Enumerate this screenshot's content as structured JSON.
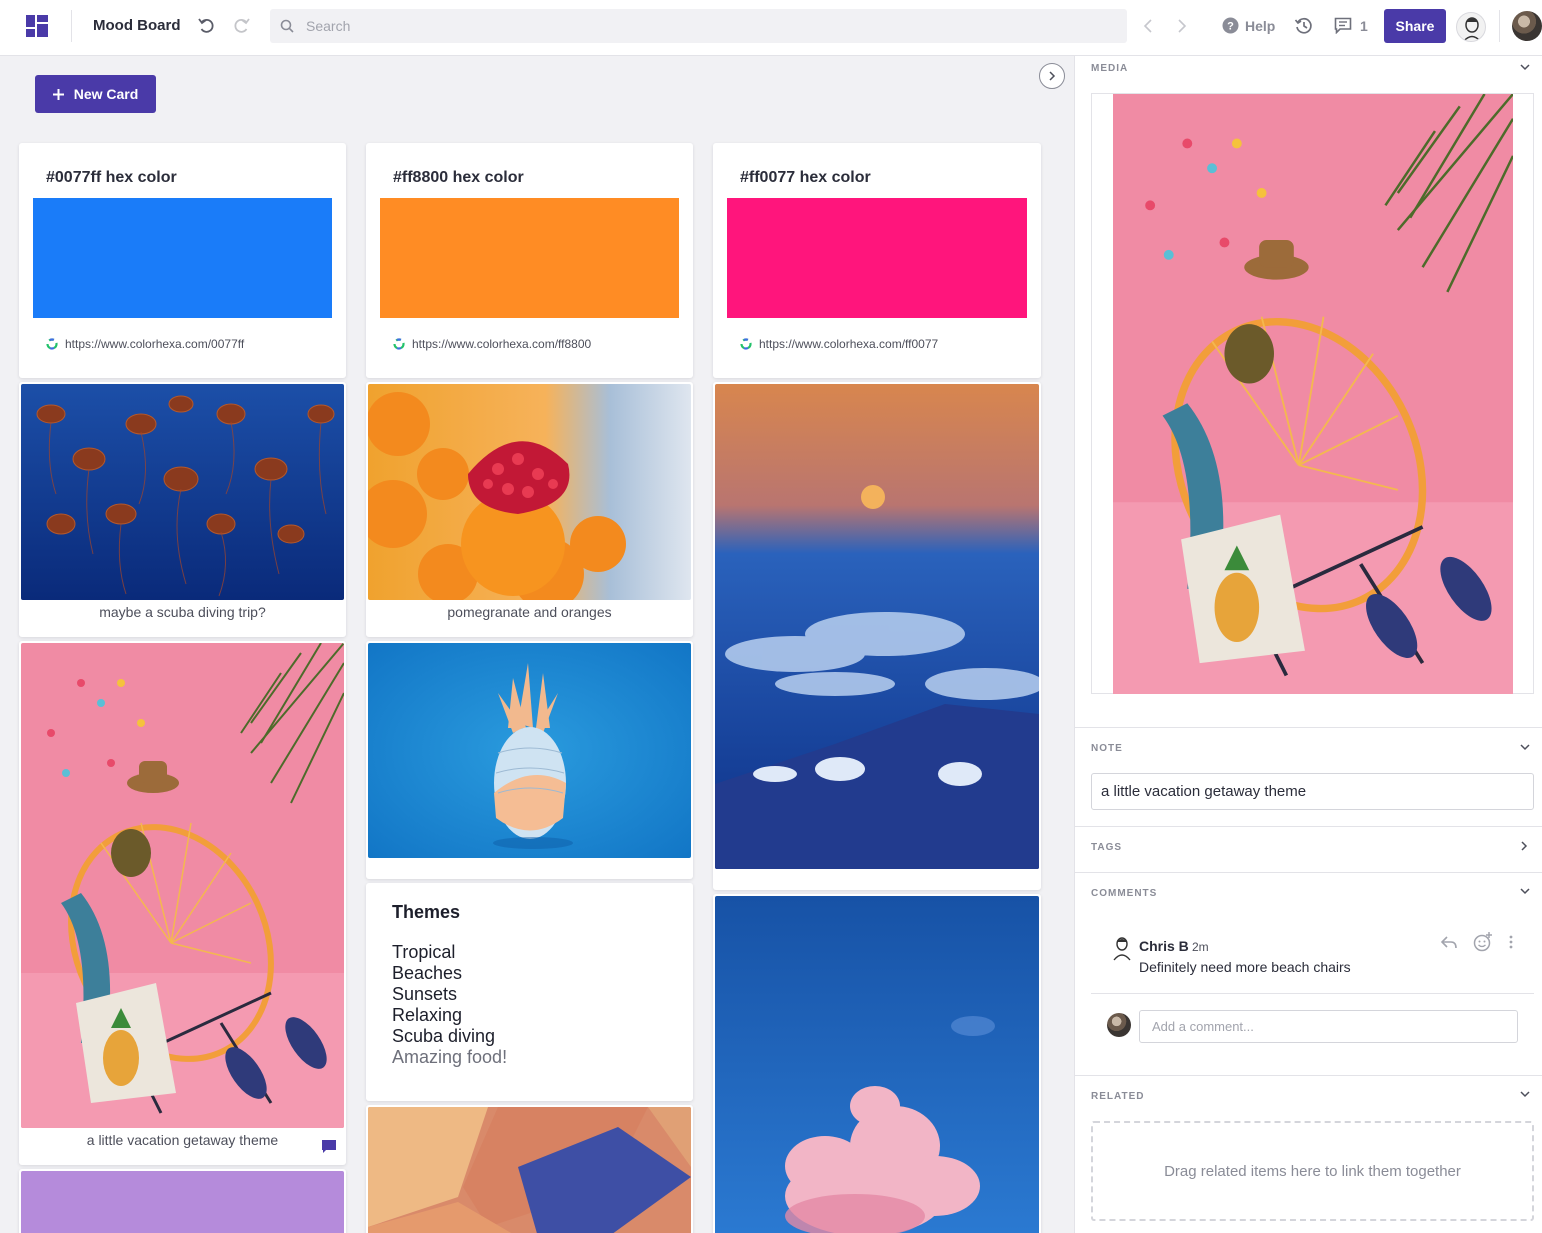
{
  "app": {
    "board_title": "Mood Board",
    "search_placeholder": "Search",
    "help_label": "Help",
    "comment_count": "1",
    "share_label": "Share",
    "accent_color": "#4a3aa8"
  },
  "board": {
    "new_card_label": "New Card",
    "hex_cards": [
      {
        "title": "#0077ff hex color",
        "color": "#0077ff",
        "url": "https://www.colorhexa.com/0077ff"
      },
      {
        "title": "#ff8800 hex color",
        "color": "#ff8800",
        "url": "https://www.colorhexa.com/ff8800"
      },
      {
        "title": "#ff0077 hex color",
        "color": "#ff0077",
        "url": "https://www.colorhexa.com/ff0077"
      }
    ],
    "image_cards": [
      {
        "caption": "maybe a scuba diving trip?",
        "image": "jellyfish"
      },
      {
        "caption": "pomegranate and oranges",
        "image": "pomegranate"
      },
      {
        "caption": "",
        "image": "sunset-clouds"
      },
      {
        "caption": "a little vacation getaway theme",
        "image": "beach-chair",
        "has_comment": true
      },
      {
        "caption": "",
        "image": "pineapple"
      },
      {
        "caption": "",
        "image": "pink-cloud"
      },
      {
        "caption": "",
        "image": "tiles"
      },
      {
        "caption": "",
        "image": "purple-swatch",
        "color": "#b58bdb"
      }
    ],
    "themes_card": {
      "title": "Themes",
      "items": [
        "Tropical",
        "Beaches",
        "Sunsets",
        "Relaxing",
        "Scuba diving",
        "Amazing food!"
      ]
    }
  },
  "panel": {
    "media_label": "MEDIA",
    "note_label": "NOTE",
    "note_value": "a little vacation getaway theme",
    "tags_label": "TAGS",
    "comments_label": "COMMENTS",
    "comment": {
      "author": "Chris B",
      "time": "2m",
      "text": "Definitely need more beach chairs"
    },
    "add_comment_placeholder": "Add a comment...",
    "related_label": "RELATED",
    "related_drop_text": "Drag related items here to link them together"
  }
}
